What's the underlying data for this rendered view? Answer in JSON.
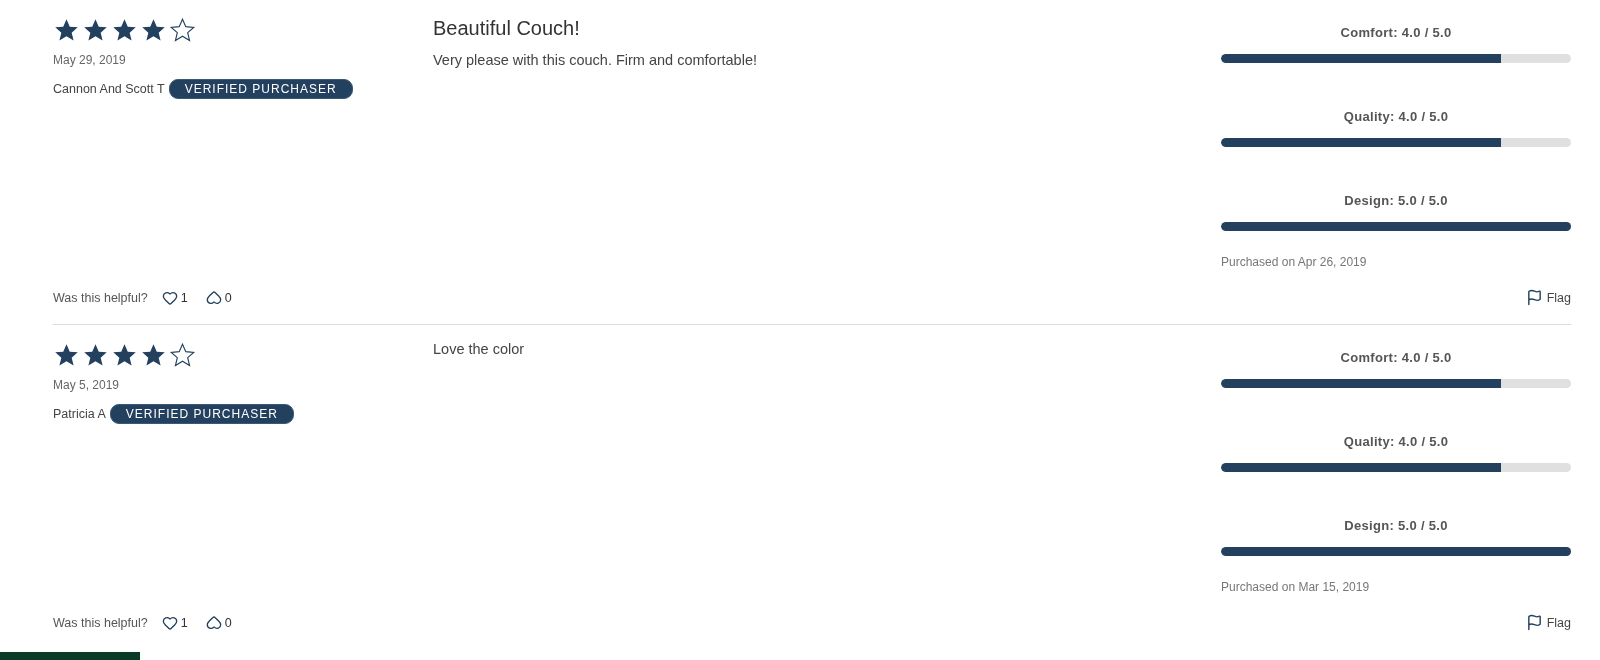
{
  "reviews": [
    {
      "stars": 4,
      "date": "May 29, 2019",
      "author": "Cannon And Scott T",
      "badge": "VERIFIED PURCHASER",
      "title": "Beautiful Couch!",
      "body": "Very please with this couch. Firm and comfortable!",
      "ratings": [
        {
          "label": "Comfort:",
          "reading": "4.0 / 5.0",
          "level": 0.8
        },
        {
          "label": "Quality:",
          "reading": "4.0 / 5.0",
          "level": 0.8
        },
        {
          "label": "Design:",
          "reading": "5.0 / 5.0",
          "level": 1
        }
      ],
      "purchased": "Purchased on Apr 26, 2019",
      "helpful_prompt": "Was this helpful?",
      "likes": "1",
      "dislikes": "0",
      "flag": "Flag"
    },
    {
      "stars": 4,
      "date": "May 5, 2019",
      "author": "Patricia A",
      "badge": "VERIFIED PURCHASER",
      "body": "Love the color",
      "ratings": [
        {
          "label": "Comfort:",
          "reading": "4.0 / 5.0",
          "level": 0.8
        },
        {
          "label": "Quality:",
          "reading": "4.0 / 5.0",
          "level": 0.8
        },
        {
          "label": "Design:",
          "reading": "5.0 / 5.0",
          "level": 1
        }
      ],
      "purchased": "Purchased on Mar 15, 2019",
      "helpful_prompt": "Was this helpful?",
      "likes": "1",
      "dislikes": "0",
      "flag": "Flag"
    }
  ]
}
